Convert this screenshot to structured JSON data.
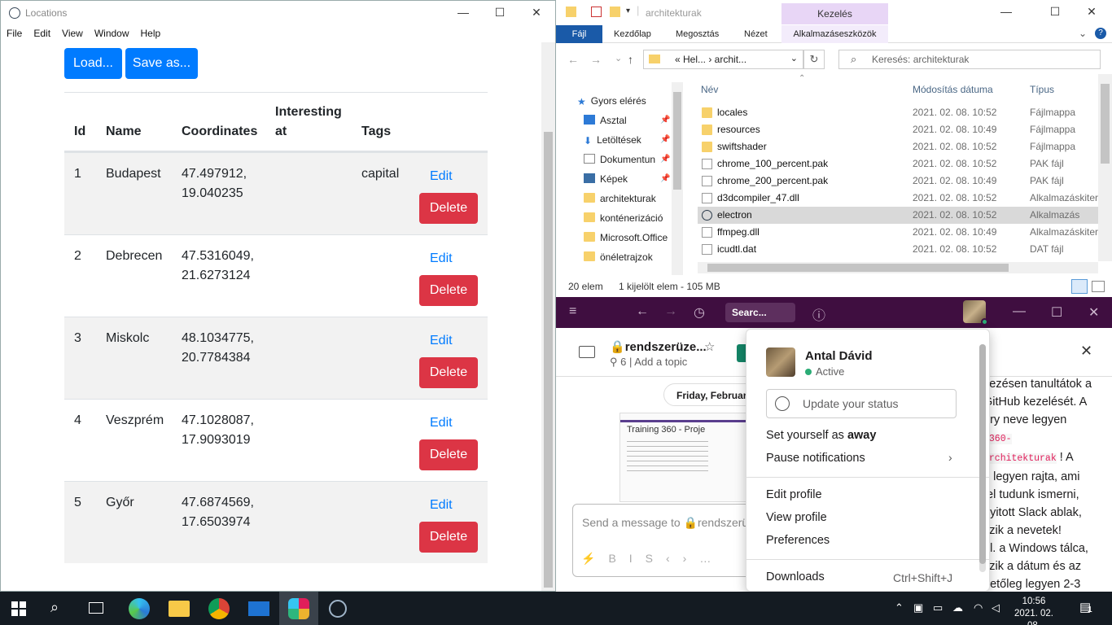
{
  "locations_window": {
    "title": "Locations",
    "menu": [
      "File",
      "Edit",
      "View",
      "Window",
      "Help"
    ],
    "load_label": "Load...",
    "save_label": "Save as...",
    "columns": [
      "Id",
      "Name",
      "Coordinates",
      "Interesting at",
      "Tags"
    ],
    "edit_label": "Edit",
    "delete_label": "Delete",
    "rows": [
      {
        "id": "1",
        "name": "Budapest",
        "lat": "47.497912,",
        "lon": "19.040235",
        "interesting": "",
        "tags": "capital"
      },
      {
        "id": "2",
        "name": "Debrecen",
        "lat": "47.5316049,",
        "lon": "21.6273124",
        "interesting": "",
        "tags": ""
      },
      {
        "id": "3",
        "name": "Miskolc",
        "lat": "48.1034775,",
        "lon": "20.7784384",
        "interesting": "",
        "tags": ""
      },
      {
        "id": "4",
        "name": "Veszprém",
        "lat": "47.1028087,",
        "lon": "17.9093019",
        "interesting": "",
        "tags": ""
      },
      {
        "id": "5",
        "name": "Győr",
        "lat": "47.6874569,",
        "lon": "17.6503974",
        "interesting": "",
        "tags": ""
      }
    ]
  },
  "explorer": {
    "title": "architekturak",
    "contextual_tab": "Kezelés",
    "ribbon_tabs": [
      "Fájl",
      "Kezdőlap",
      "Megosztás",
      "Nézet",
      "Alkalmazáseszközök"
    ],
    "address": "« Hel... › archit...",
    "search_placeholder": "Keresés: architekturak",
    "nav_items": [
      {
        "label": "Gyors elérés",
        "icon": "star-icon"
      },
      {
        "label": "Asztal",
        "icon": "desktop-icon",
        "pinned": true
      },
      {
        "label": "Letöltések",
        "icon": "download-icon",
        "pinned": true
      },
      {
        "label": "Dokumentun",
        "icon": "document-icon",
        "pinned": true
      },
      {
        "label": "Képek",
        "icon": "pictures-icon",
        "pinned": true
      },
      {
        "label": "architekturak",
        "icon": "folder-icon"
      },
      {
        "label": "konténerizáció",
        "icon": "folder-icon"
      },
      {
        "label": "Microsoft.Office",
        "icon": "folder-icon"
      },
      {
        "label": "önéletrajzok",
        "icon": "folder-icon"
      }
    ],
    "columns": [
      "Név",
      "Módosítás dátuma",
      "Típus"
    ],
    "files": [
      {
        "name": "locales",
        "date": "2021. 02. 08. 10:52",
        "type": "Fájlmappa",
        "icon": "folder-icon"
      },
      {
        "name": "resources",
        "date": "2021. 02. 08. 10:49",
        "type": "Fájlmappa",
        "icon": "folder-icon"
      },
      {
        "name": "swiftshader",
        "date": "2021. 02. 08. 10:52",
        "type": "Fájlmappa",
        "icon": "folder-icon"
      },
      {
        "name": "chrome_100_percent.pak",
        "date": "2021. 02. 08. 10:52",
        "type": "PAK fájl",
        "icon": "file-icon"
      },
      {
        "name": "chrome_200_percent.pak",
        "date": "2021. 02. 08. 10:49",
        "type": "PAK fájl",
        "icon": "file-icon"
      },
      {
        "name": "d3dcompiler_47.dll",
        "date": "2021. 02. 08. 10:52",
        "type": "Alkalmazáskiter",
        "icon": "dll-icon"
      },
      {
        "name": "electron",
        "date": "2021. 02. 08. 10:52",
        "type": "Alkalmazás",
        "icon": "electron-icon",
        "selected": true
      },
      {
        "name": "ffmpeg.dll",
        "date": "2021. 02. 08. 10:49",
        "type": "Alkalmazáskiter",
        "icon": "dll-icon"
      },
      {
        "name": "icudtl.dat",
        "date": "2021. 02. 08. 10:52",
        "type": "DAT fájl",
        "icon": "file-icon"
      }
    ],
    "status_count": "20 elem",
    "status_selected": "1 kijelölt elem - 105 MB"
  },
  "slack": {
    "search": "Searc...",
    "channel": "rendszerüze...",
    "member_count": "6",
    "add_topic": "Add a topic",
    "day_divider": "Friday, Februar",
    "preview_title": "Training 360 - Proje",
    "compose_placeholder": "Send a message to 🔒rendszerüz",
    "right_text": {
      "l1": "vezésen tanultátok a",
      "l2": "GitHub kezelését. A",
      "l3": "ory neve legyen",
      "l4_code": "g360-",
      "l5_code": "architekturak",
      "l5_rest": "! A",
      "l6": "n legyen rajta, ami",
      "l7": "fel tudunk ismerni,",
      "l8": "nyitott Slack ablak,",
      "l9": "szik a nevetek!",
      "l10": "ol. a Windows tálca,",
      "l11": "szik a dátum és az",
      "l12": "hetőleg legyen 2-3"
    },
    "menu": {
      "user_name": "Antal Dávid",
      "presence": "Active",
      "status_placeholder": "Update your status",
      "set_away_prefix": "Set yourself as ",
      "set_away_bold": "away",
      "pause": "Pause notifications",
      "edit_profile": "Edit profile",
      "view_profile": "View profile",
      "preferences": "Preferences",
      "downloads": "Downloads",
      "downloads_shortcut": "Ctrl+Shift+J"
    }
  },
  "taskbar": {
    "time": "10:56",
    "date": "2021. 02. 08.",
    "notification_count": "1"
  },
  "colors": {
    "primary": "#007bff",
    "danger": "#dc3545",
    "slack_aubergine": "#3f0e40",
    "explorer_blue": "#1a5aa8",
    "taskbar": "#141b22"
  }
}
